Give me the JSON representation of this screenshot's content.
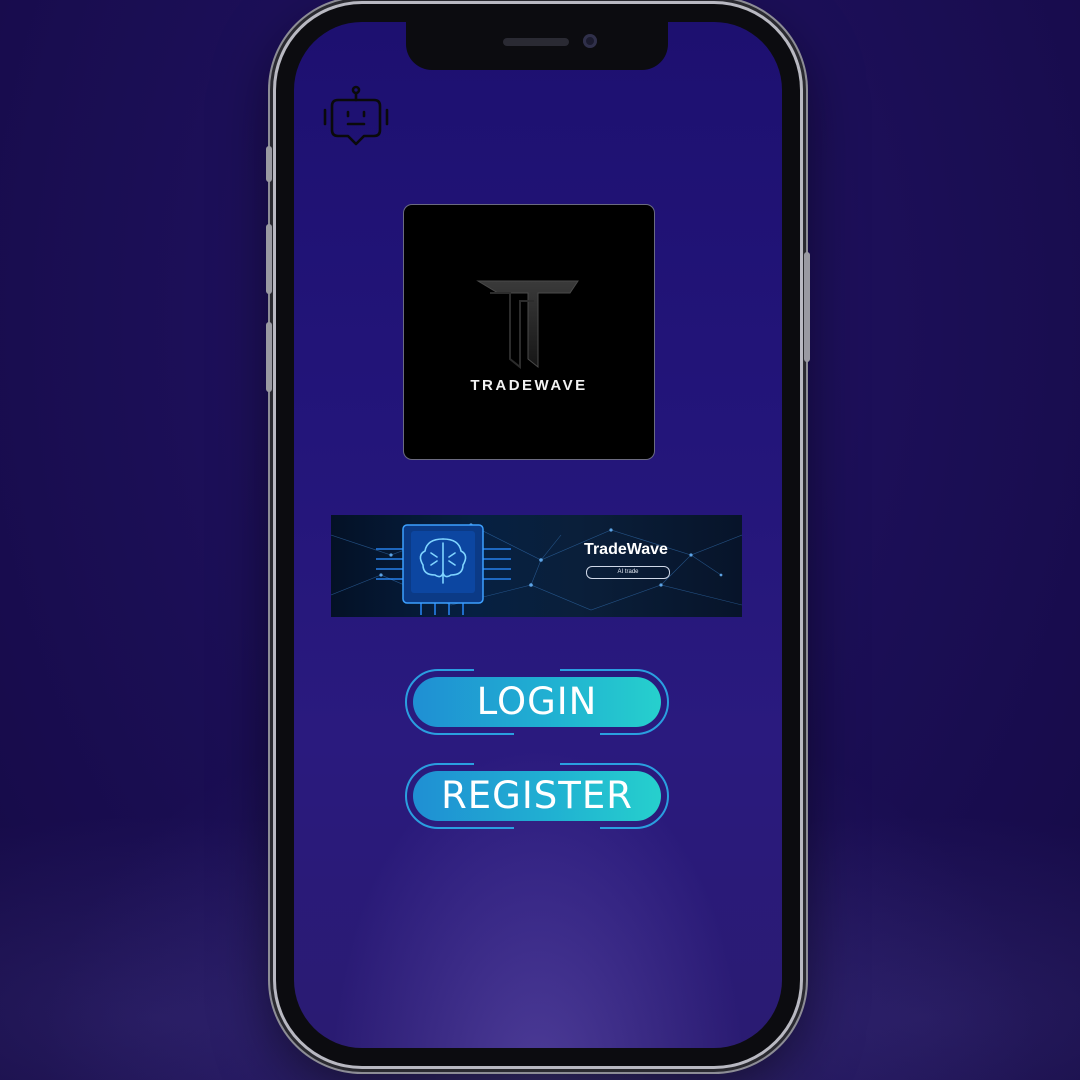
{
  "app": {
    "logo_text": "TRADEWAVE"
  },
  "banner": {
    "title": "TradeWave",
    "pill": "AI trade"
  },
  "actions": {
    "login_label": "LOGIN",
    "register_label": "REGISTER"
  },
  "icons": {
    "assistant": "chat-bot-icon"
  },
  "colors": {
    "background": "#1c0f58",
    "screen": "#23157a",
    "button_start": "#1f8fd3",
    "button_end": "#26d0cd",
    "button_frame": "#2a9fe0",
    "logo_card": "#000000"
  }
}
